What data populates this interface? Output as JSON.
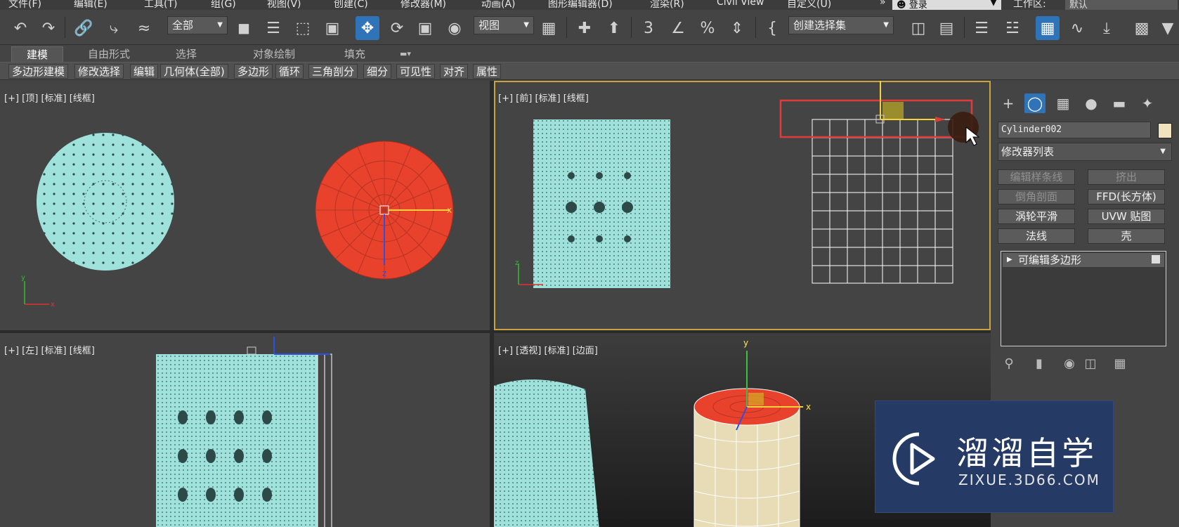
{
  "menu": [
    "文件(F)",
    "编辑(E)",
    "工具(T)",
    "组(G)",
    "视图(V)",
    "创建(C)",
    "修改器(M)",
    "动画(A)",
    "图形编辑器(D)",
    "渲染(R)",
    "Civil View",
    "自定义(U)",
    "»"
  ],
  "login": "登录",
  "workspace_label": "工作区:",
  "workspace_value": "默认",
  "toolbar": {
    "filter_value": "全部",
    "ref_coord_value": "视图",
    "selset_placeholder": "创建选择集"
  },
  "ribbon_tabs": [
    "建模",
    "自由形式",
    "选择",
    "对象绘制",
    "填充"
  ],
  "ribbon_buttons": [
    "多边形建模",
    "修改选择",
    "编辑",
    "几何体(全部)",
    "多边形",
    "循环",
    "三角剖分",
    "细分",
    "可见性",
    "对齐",
    "属性"
  ],
  "viewports": {
    "top_left": "[+] [顶] [标准] [线框]",
    "top_right": "[+] [前] [标准] [线框]",
    "bottom_left": "[+] [左] [标准] [线框]",
    "bottom_right": "[+] [透视] [标准] [边面]"
  },
  "command_panel": {
    "object_name": "Cylinder002",
    "modifier_list": "修改器列表",
    "modifier_buttons": [
      "编辑样条线",
      "挤出",
      "倒角剖面",
      "FFD(长方体)",
      "涡轮平滑",
      "UVW 贴图",
      "法线",
      "壳"
    ],
    "stack_item": "可编辑多边形"
  },
  "watermark": {
    "title": "溜溜自学",
    "url": "ZIXUE.3D66.COM"
  },
  "colors": {
    "selection": "#e8412c",
    "mesh": "#9fe2dc",
    "active_viewport": "#c8a53c",
    "active_button": "#2f74b8"
  }
}
